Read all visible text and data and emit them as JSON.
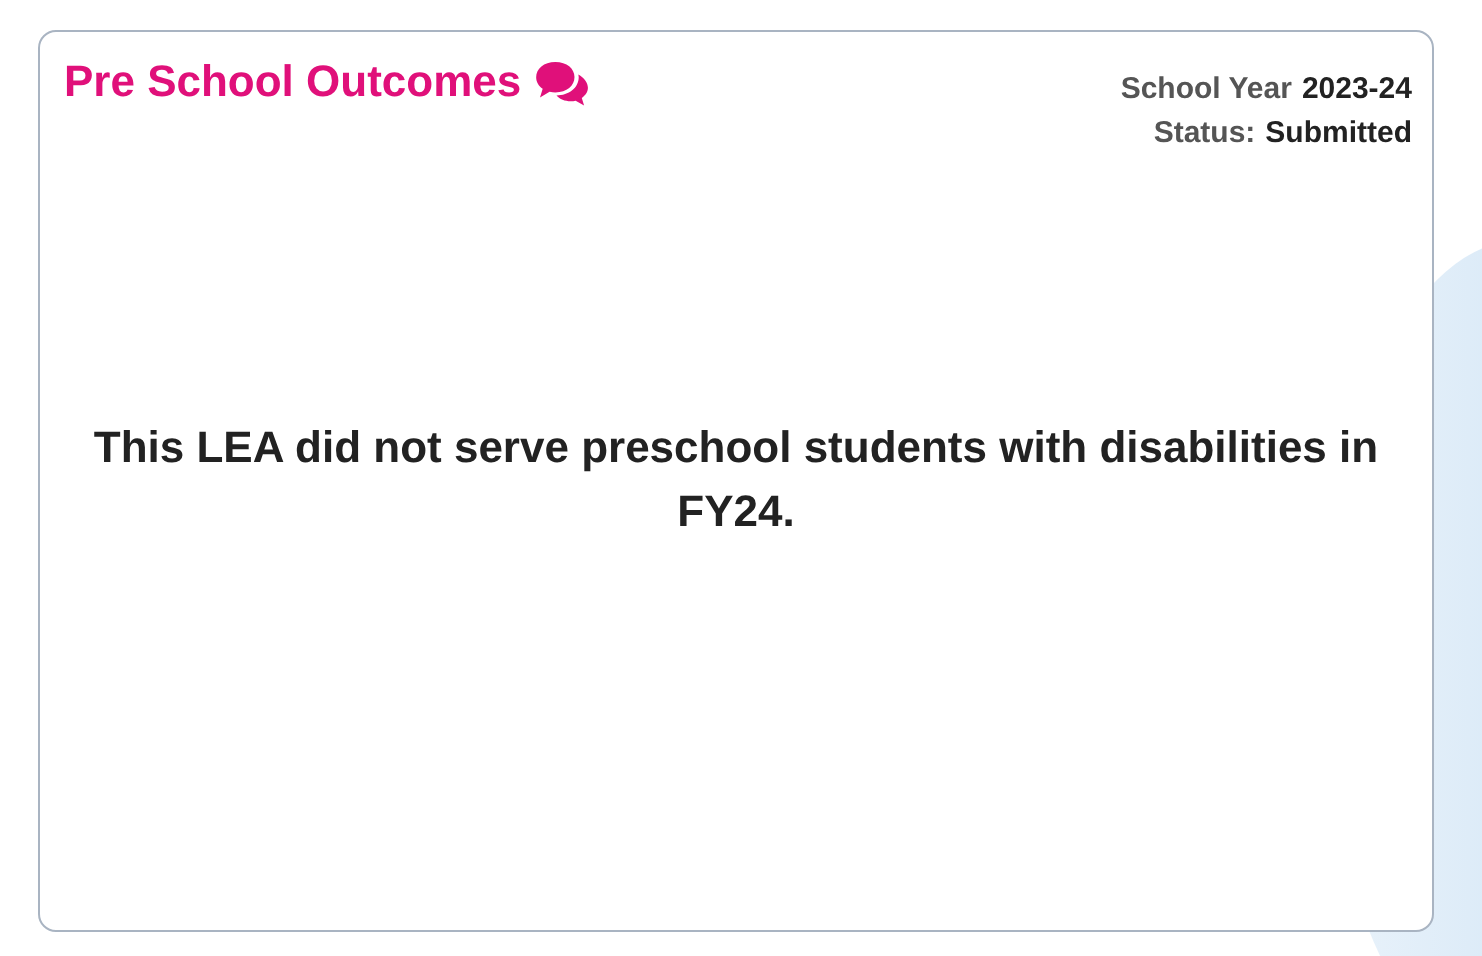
{
  "card": {
    "title": "Pre School Outcomes",
    "meta": [
      {
        "label": "School Year",
        "value": "2023-24"
      },
      {
        "label": "Status:",
        "value": "Submitted"
      }
    ],
    "message": "This LEA did not serve preschool students with disabilities in FY24."
  }
}
